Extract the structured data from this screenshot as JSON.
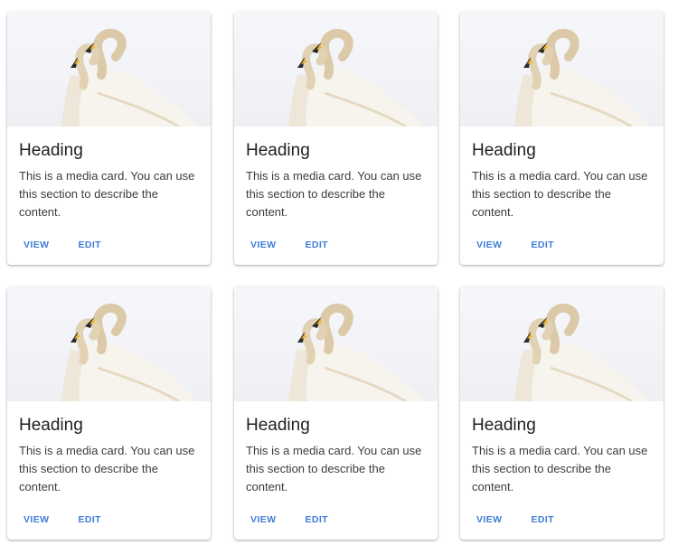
{
  "cards": [
    {
      "image_alt": "Two white swans",
      "heading": "Heading",
      "description": "This is a media card. You can use this section to describe the content.",
      "view_label": "VIEW",
      "edit_label": "EDIT"
    },
    {
      "image_alt": "Two white swans",
      "heading": "Heading",
      "description": "This is a media card. You can use this section to describe the content.",
      "view_label": "VIEW",
      "edit_label": "EDIT"
    },
    {
      "image_alt": "Two white swans",
      "heading": "Heading",
      "description": "This is a media card. You can use this section to describe the content.",
      "view_label": "VIEW",
      "edit_label": "EDIT"
    },
    {
      "image_alt": "Two white swans",
      "heading": "Heading",
      "description": "This is a media card. You can use this section to describe the content.",
      "view_label": "VIEW",
      "edit_label": "EDIT"
    },
    {
      "image_alt": "Two white swans",
      "heading": "Heading",
      "description": "This is a media card. You can use this section to describe the content.",
      "view_label": "VIEW",
      "edit_label": "EDIT"
    },
    {
      "image_alt": "Two white swans",
      "heading": "Heading",
      "description": "This is a media card. You can use this section to describe the content.",
      "view_label": "VIEW",
      "edit_label": "EDIT"
    }
  ],
  "colors": {
    "accent": "#3f7cd8",
    "heading": "#1f1f1f",
    "body_text": "#3c3c3c",
    "card_bg": "#ffffff",
    "media_bg": "#f3f4f7"
  }
}
